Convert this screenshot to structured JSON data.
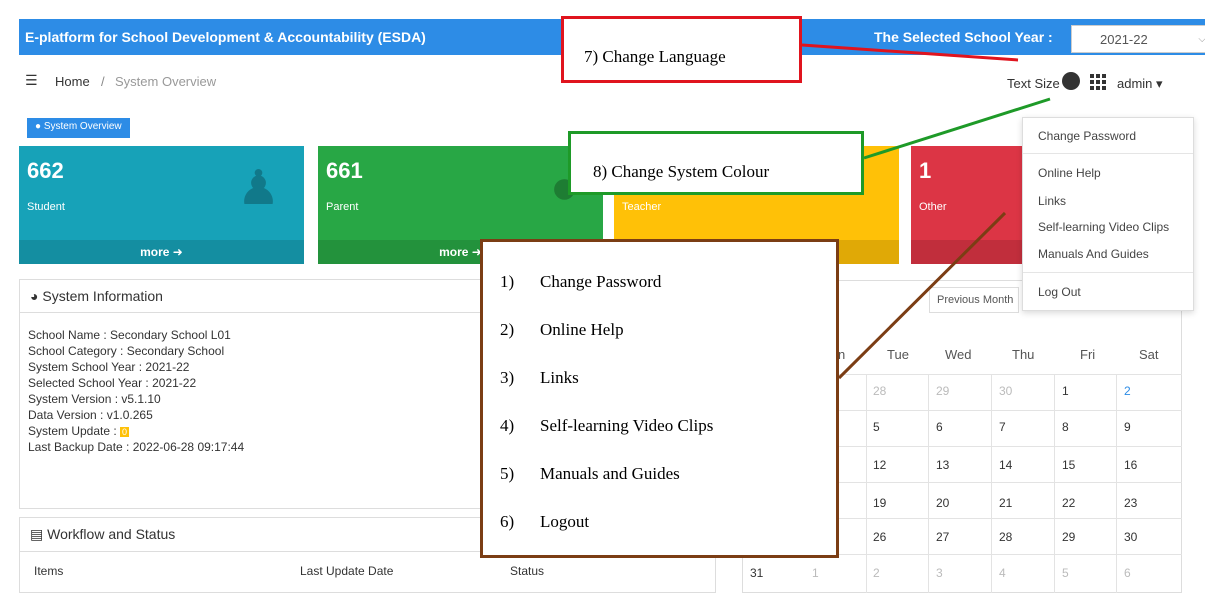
{
  "topbar": {
    "title": "E-platform for School Development & Accountability (ESDA)",
    "school_year_label": "The Selected School Year :",
    "school_year_value": "2021-22"
  },
  "breadcrumb": {
    "home": "Home",
    "separator": "/",
    "current": "System Overview",
    "text_size": "Text Size",
    "user": "admin ▾"
  },
  "tag": "● System Overview",
  "cards": [
    {
      "value": "662",
      "label": "Student",
      "more": "more ➜",
      "color": "#17a2b8",
      "icon": "person-icon"
    },
    {
      "value": "661",
      "label": "Parent",
      "more": "more ➜",
      "color": "#28a745",
      "icon": "users-icon"
    },
    {
      "value": "",
      "label": "Teacher",
      "more": "",
      "color": "#ffc107",
      "icon": "teacher-icon"
    },
    {
      "value": "1",
      "label": "Other",
      "more": "",
      "color": "#dc3545",
      "icon": "other-icon"
    }
  ],
  "system_info": {
    "title": "System Information",
    "lines": [
      "School Name : Secondary School L01",
      "School Category : Secondary School",
      "System School Year : 2021-22",
      "Selected School Year : 2021-22",
      "System Version : v5.1.10",
      "Data Version : v1.0.265",
      "System Update : ",
      "Last Backup Date : 2022-06-28 09:17:44"
    ],
    "update_badge": "0"
  },
  "workflow": {
    "title": "Workflow and Status",
    "columns": [
      "Items",
      "Last Update Date",
      "Status"
    ]
  },
  "calendar": {
    "prev_button": "Previous Month",
    "days": [
      "n",
      "Tue",
      "Wed",
      "Thu",
      "Fri",
      "Sat"
    ],
    "rows": [
      [
        "28",
        "29",
        "30",
        "1",
        "2"
      ],
      [
        "5",
        "6",
        "7",
        "8",
        "9"
      ],
      [
        "12",
        "13",
        "14",
        "15",
        "16"
      ],
      [
        "19",
        "20",
        "21",
        "22",
        "23"
      ],
      [
        "26",
        "27",
        "28",
        "29",
        "30"
      ],
      [
        "31",
        "1",
        "2",
        "3",
        "4",
        "5",
        "6"
      ]
    ]
  },
  "dropdown": {
    "items": [
      "Change Password",
      "Online Help",
      "Links",
      "Self-learning Video Clips",
      "Manuals And Guides",
      "Log Out"
    ]
  },
  "annotations": {
    "language": "7) Change Language",
    "colour": "8) Change System Colour",
    "list": [
      {
        "n": "1)",
        "text": "Change Password"
      },
      {
        "n": "2)",
        "text": "Online Help"
      },
      {
        "n": "3)",
        "text": "Links"
      },
      {
        "n": "4)",
        "text": "Self-learning Video Clips"
      },
      {
        "n": "5)",
        "text": "Manuals and Guides"
      },
      {
        "n": "6)",
        "text": "Logout"
      }
    ]
  }
}
